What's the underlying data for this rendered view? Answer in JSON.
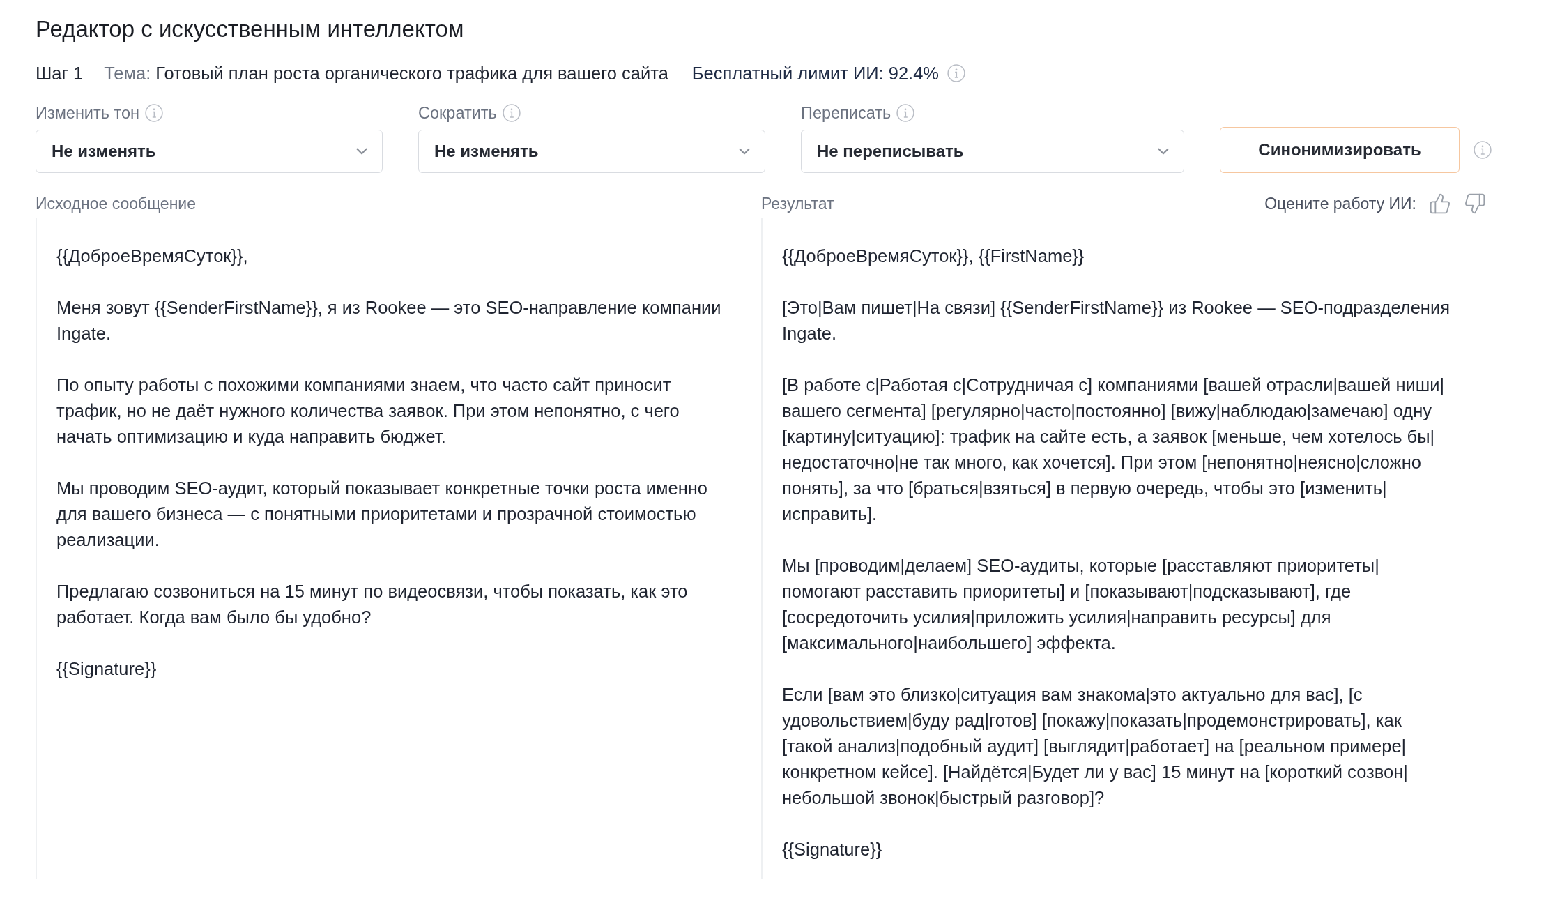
{
  "title": "Редактор с искусственным интеллектом",
  "step": "Шаг 1",
  "topic": {
    "label": "Тема:",
    "value": "Готовый план роста органического трафика для вашего сайта"
  },
  "ai_limit": "Бесплатный лимит ИИ: 92.4%",
  "controls": [
    {
      "kind": "select",
      "label": "Изменить тон",
      "value": "Не изменять"
    },
    {
      "kind": "select",
      "label": "Сократить",
      "value": "Не изменять"
    },
    {
      "kind": "select",
      "label": "Переписать",
      "value": "Не переписывать"
    },
    {
      "kind": "button",
      "label": "Синонимизировать"
    }
  ],
  "source": {
    "heading": "Исходное сообщение",
    "paragraphs": [
      {
        "lines": [
          "{{ДоброеВремяСуток}},"
        ]
      },
      {
        "lines": [
          "Меня зовут {{SenderFirstName}}, я из Rookee — это SEO-направление компании",
          "Ingate."
        ]
      },
      {
        "lines": [
          "По опыту работы с похожими компаниями знаем, что часто сайт приносит",
          "трафик, но не даёт нужного количества заявок. При этом непонятно, с чего",
          "начать оптимизацию и куда направить бюджет."
        ]
      },
      {
        "lines": [
          "Мы проводим SEO-аудит, который показывает конкретные точки роста именно",
          "для вашего бизнеса — с понятными приоритетами и прозрачной стоимостью",
          "реализации."
        ]
      },
      {
        "lines": [
          "Предлагаю созвониться на 15 минут по видеосвязи, чтобы показать, как это",
          "работает. Когда вам было бы удобно?"
        ]
      },
      {
        "lines": [
          "{{Signature}}"
        ]
      }
    ]
  },
  "result": {
    "heading": "Результат",
    "rating_prompt": "Оцените работу ИИ:",
    "paragraphs": [
      {
        "lines": [
          "{{ДоброеВремяСуток}}, {{FirstName}}"
        ]
      },
      {
        "lines": [
          "[Это|Вам пишет|На связи] {{SenderFirstName}} из Rookee — SEO-подразделения",
          "Ingate."
        ]
      },
      {
        "lines": [
          "[В работе с|Работая с|Сотрудничая с] компаниями [вашей отрасли|вашей ниши|",
          "вашего сегмента] [регулярно|часто|постоянно] [вижу|наблюдаю|замечаю] одну",
          "[картину|ситуацию]: трафик на сайте есть, а заявок [меньше, чем хотелось бы|",
          "недостаточно|не так много, как хочется]. При этом [непонятно|неясно|сложно",
          "понять], за что [браться|взяться] в первую очередь, чтобы это [изменить|",
          "исправить]."
        ]
      },
      {
        "lines": [
          "Мы [проводим|делаем] SEO-аудиты, которые [расставляют приоритеты|",
          "помогают расставить приоритеты] и [показывают|подсказывают], где",
          "[сосредоточить усилия|приложить усилия|направить ресурсы] для",
          "[максимального|наибольшего] эффекта."
        ]
      },
      {
        "lines": [
          "Если [вам это близко|ситуация вам знакома|это актуально для вас], [с",
          "удовольствием|буду рад|готов] [покажу|показать|продемонстрировать], как",
          "[такой анализ|подобный аудит] [выглядит|работает] на [реальном примере|",
          "конкретном кейсе]. [Найдётся|Будет ли у вас] 15 минут на [короткий созвон|",
          "небольшой звонок|быстрый разговор]?"
        ]
      },
      {
        "lines": [
          "{{Signature}}"
        ]
      }
    ]
  }
}
